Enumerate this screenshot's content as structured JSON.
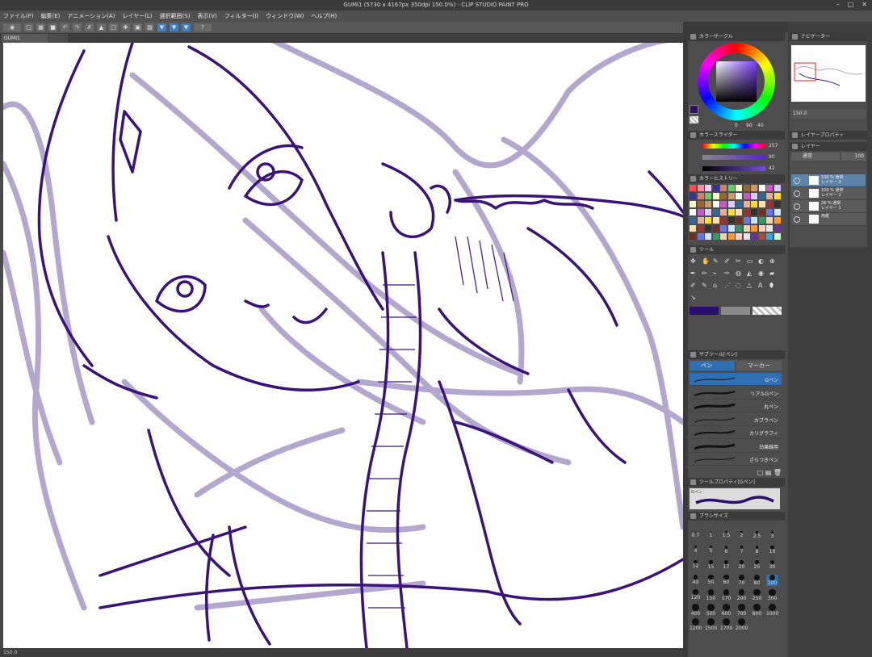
{
  "window": {
    "title": "GUMI1 (5730 x 4167px 350dpi 150.0%)  - CLIP STUDIO PAINT PRO",
    "min_icon": "minimize-icon",
    "max_icon": "maximize-icon",
    "close_icon": "close-icon"
  },
  "menu": [
    "ファイル(F)",
    "編集(E)",
    "アニメーション(A)",
    "レイヤー(L)",
    "選択範囲(S)",
    "表示(V)",
    "フィルター(I)",
    "ウィンドウ(W)",
    "ヘルプ(H)"
  ],
  "document_tab": "GUMI1",
  "status": {
    "zoom": "150.0"
  },
  "panels": {
    "color_wheel": {
      "title": "カラーサークル",
      "values": [
        "0",
        "90",
        "40"
      ]
    },
    "color_slider": {
      "title": "カラースライダー",
      "values": [
        "257",
        "90",
        "42"
      ]
    },
    "color_set": {
      "title": "カラーヒストリー"
    },
    "navigator": {
      "title": "ナビゲーター",
      "zoom": "150.0"
    },
    "layer_property": {
      "title": "レイヤープロパティ"
    },
    "layer": {
      "title": "レイヤー",
      "blend": "通常",
      "opacity": "100",
      "rows": [
        {
          "line1": "100 % 通常",
          "line2": "レイヤー 3"
        },
        {
          "line1": "100 % 通常",
          "line2": "レイヤー 2"
        },
        {
          "line1": "26 % 通常",
          "line2": "レイヤー 1"
        },
        {
          "line1": "",
          "line2": "用紙"
        }
      ]
    },
    "tool": {
      "title": "ツール"
    },
    "subtool": {
      "title": "サブツール[ペン]",
      "tabs": [
        "ペン",
        "マーカー"
      ],
      "brushes": [
        "Gペン",
        "リアルGペン",
        "丸ペン",
        "カブラペン",
        "カリグラフィ",
        "効果線用",
        "ざらつきペン"
      ]
    },
    "tool_property": {
      "title": "ツールプロパティ[Gペン]",
      "preset": "Gペン"
    },
    "brush_size": {
      "title": "ブラシサイズ",
      "sizes": [
        "0.7",
        "1",
        "1.5",
        "2",
        "2.5",
        "3",
        "4",
        "5",
        "6",
        "7",
        "8",
        "10",
        "12",
        "15",
        "17",
        "20",
        "25",
        "30",
        "40",
        "50",
        "60",
        "70",
        "80",
        "100",
        "120",
        "150",
        "170",
        "200",
        "250",
        "300",
        "400",
        "500",
        "600",
        "700",
        "800",
        "1000",
        "1200",
        "1500",
        "1700",
        "2000"
      ],
      "selected": "100"
    }
  },
  "colors": {
    "ui_bg": "#4d4d4d",
    "selection": "#2f6fb3",
    "line_art": "#3b1378",
    "rough_sketch": "#b3a6cf",
    "main_color": "#2a0d6e"
  }
}
